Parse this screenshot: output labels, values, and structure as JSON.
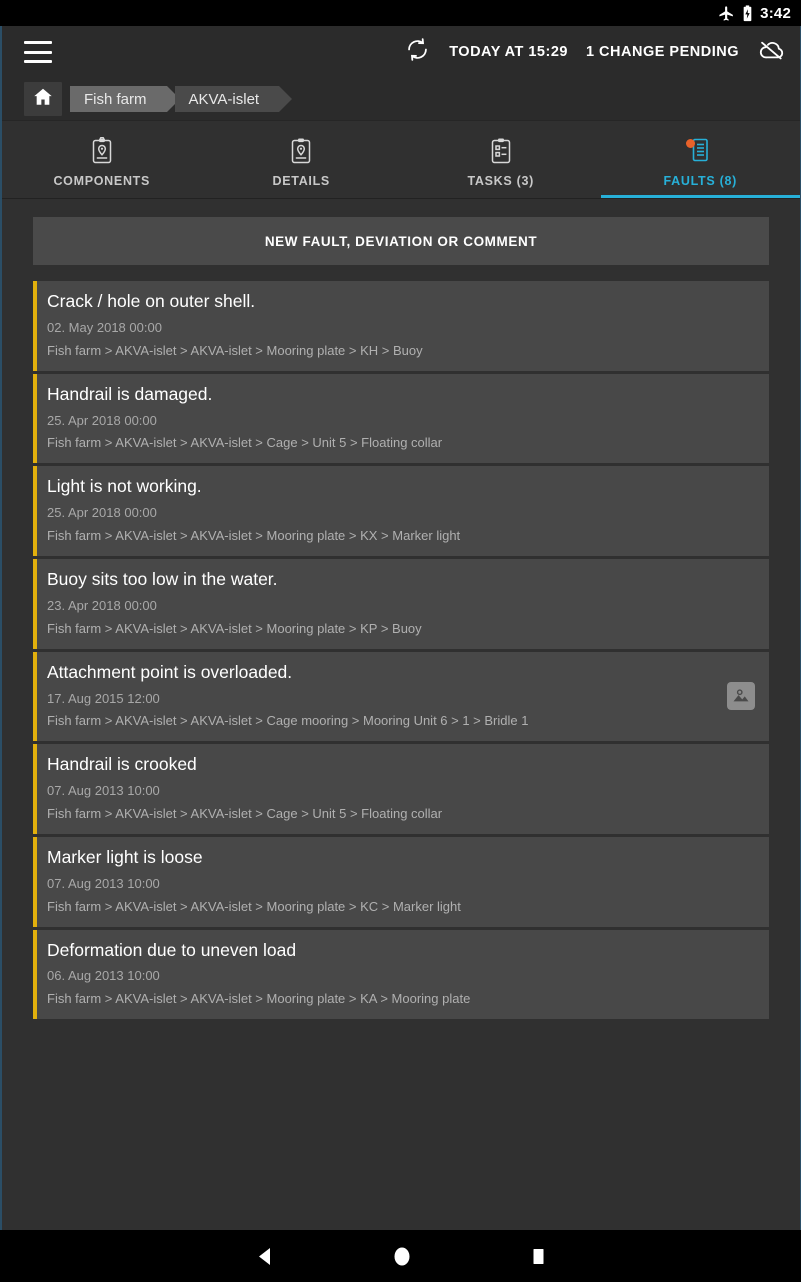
{
  "statusbar": {
    "airplane_icon": "airplane-mode-icon",
    "battery_icon": "battery-charging-icon",
    "time": "3:42"
  },
  "actionbar": {
    "menu_icon": "hamburger-menu-icon",
    "sync_icon": "sync-icon",
    "sync_time": "TODAY AT 15:29",
    "pending_changes": "1 CHANGE PENDING",
    "cloud_icon": "cloud-off-icon"
  },
  "breadcrumb": {
    "home_icon": "home-icon",
    "items": [
      {
        "label": "Fish farm"
      },
      {
        "label": "AKVA-islet"
      }
    ]
  },
  "tabs": [
    {
      "label": "COMPONENTS",
      "icon": "clipboard-pin-icon",
      "active": false,
      "badge": false
    },
    {
      "label": "DETAILS",
      "icon": "clipboard-pin-icon",
      "active": false,
      "badge": false
    },
    {
      "label": "TASKS (3)",
      "icon": "clipboard-checklist-icon",
      "active": false,
      "badge": false
    },
    {
      "label": "FAULTS (8)",
      "icon": "fault-document-icon",
      "active": true,
      "badge": true
    }
  ],
  "main": {
    "new_fault_button": "NEW FAULT, DEVIATION OR COMMENT",
    "faults": [
      {
        "title": "Crack / hole on outer shell.",
        "date": "02. May 2018 00:00",
        "path": "Fish farm > AKVA-islet > AKVA-islet > Mooring plate > KH > Buoy",
        "has_image": false
      },
      {
        "title": "Handrail is damaged.",
        "date": "25. Apr 2018 00:00",
        "path": "Fish farm > AKVA-islet > AKVA-islet > Cage > Unit 5 > Floating collar",
        "has_image": false
      },
      {
        "title": "Light is not working.",
        "date": "25. Apr 2018 00:00",
        "path": "Fish farm > AKVA-islet > AKVA-islet > Mooring plate > KX > Marker light",
        "has_image": false
      },
      {
        "title": "Buoy sits too low in the water.",
        "date": "23. Apr 2018 00:00",
        "path": "Fish farm > AKVA-islet > AKVA-islet > Mooring plate > KP > Buoy",
        "has_image": false
      },
      {
        "title": "Attachment point is overloaded.",
        "date": "17. Aug 2015 12:00",
        "path": "Fish farm > AKVA-islet > AKVA-islet > Cage mooring > Mooring Unit 6 > 1 > Bridle 1",
        "has_image": true
      },
      {
        "title": "Handrail is crooked",
        "date": "07. Aug 2013 10:00",
        "path": "Fish farm > AKVA-islet > AKVA-islet > Cage > Unit 5 > Floating collar",
        "has_image": false
      },
      {
        "title": "Marker light is loose",
        "date": "07. Aug 2013 10:00",
        "path": "Fish farm > AKVA-islet > AKVA-islet > Mooring plate > KC > Marker light",
        "has_image": false
      },
      {
        "title": "Deformation due to uneven load",
        "date": "06. Aug 2013 10:00",
        "path": "Fish farm > AKVA-islet > AKVA-islet > Mooring plate > KA > Mooring plate",
        "has_image": false
      }
    ]
  },
  "navbar": {
    "back_icon": "back-triangle-icon",
    "home_icon": "home-circle-icon",
    "recents_icon": "recents-square-icon"
  },
  "colors": {
    "accent_cyan": "#27b0d8",
    "fault_bar_yellow": "#e2b00d",
    "badge_orange": "#e8622a",
    "app_bg": "#303030",
    "card_bg": "#484848"
  }
}
